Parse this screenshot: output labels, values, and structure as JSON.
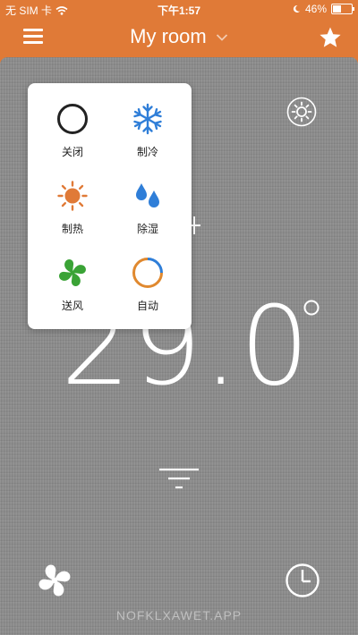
{
  "status_bar": {
    "carrier": "无 SIM 卡",
    "time": "下午1:57",
    "battery": "46%",
    "battery_level": 0.46
  },
  "header": {
    "title": "My room",
    "accent_color": "#e07a37"
  },
  "modes": [
    {
      "label": "关闭",
      "icon": "power-off-icon"
    },
    {
      "label": "制冷",
      "icon": "snowflake-icon",
      "color": "#2f7ed8"
    },
    {
      "label": "制热",
      "icon": "sun-icon",
      "color": "#e07a37"
    },
    {
      "label": "除湿",
      "icon": "water-drops-icon",
      "color": "#2f7ed8"
    },
    {
      "label": "送风",
      "icon": "fan-icon",
      "color": "#3aa336"
    },
    {
      "label": "自动",
      "icon": "auto-ring-icon",
      "color": "#e0892f"
    }
  ],
  "thermostat": {
    "temperature": "29.0",
    "unit_symbol": "°"
  },
  "watermark": "NOFKLXAWET.APP"
}
